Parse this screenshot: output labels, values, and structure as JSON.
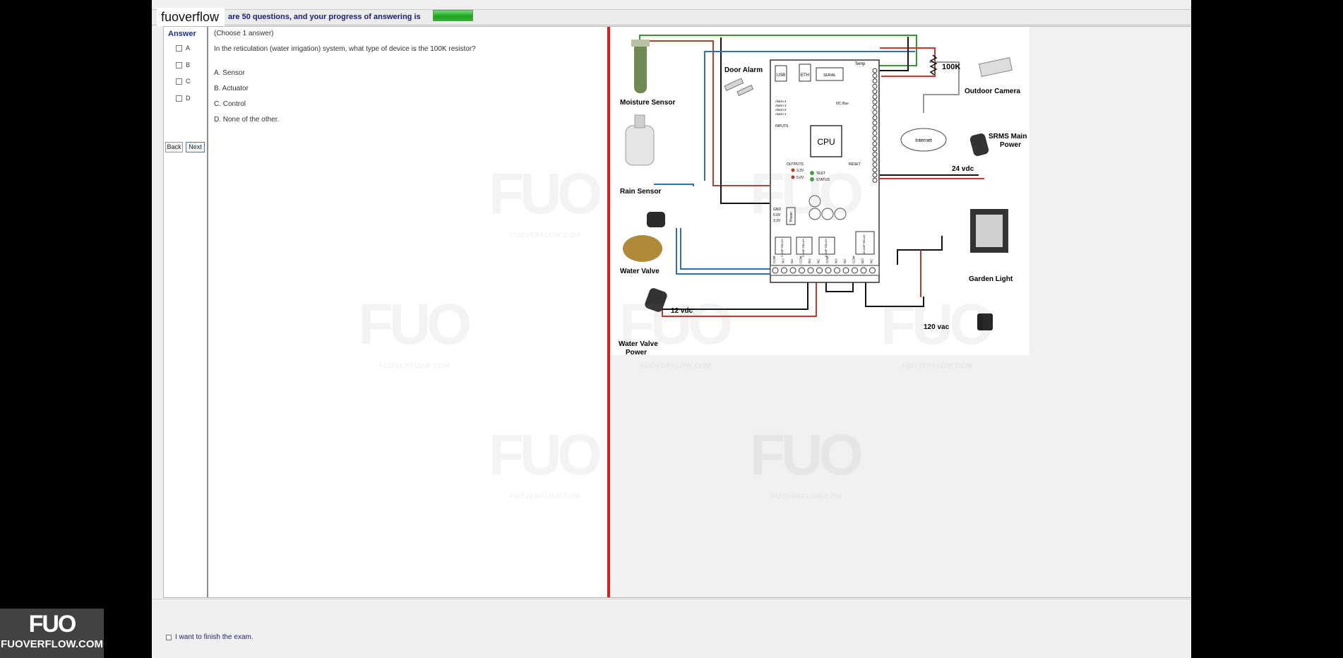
{
  "brand": "fuoverflow",
  "progress": {
    "text": "are 50 questions, and your progress of answering is",
    "fraction": 0.2
  },
  "answer_panel": {
    "title": "Answer",
    "options": [
      "A",
      "B",
      "C",
      "D"
    ],
    "back_label": "Back",
    "next_label": "Next"
  },
  "question": {
    "instruction": "(Choose 1 answer)",
    "stem": "In the reticulation  (water irrigation) system, what type of device is the 100K resistor?",
    "choices": [
      "A.  Sensor",
      "B.  Actuator",
      "C.  Control",
      "D.  None of the other."
    ]
  },
  "diagram": {
    "labels": {
      "moisture": "Moisture Sensor",
      "door": "Door Alarm",
      "rain": "Rain Sensor",
      "water_valve": "Water Valve",
      "v12": "12 vdc",
      "wv_power_1": "Water Valve",
      "wv_power_2": "Power",
      "resistor": "100K",
      "camera": "Outdoor Camera",
      "internet": "Internet",
      "srms_1": "SRMS Main",
      "srms_2": "Power",
      "v24": "24 vdc",
      "garden": "Garden Light",
      "v120": "120 vac"
    },
    "board": {
      "usb": "USB",
      "eth": "ETH",
      "serial": "SERIAL",
      "temp": "Temp",
      "cpu": "CPU",
      "inputs": "INPUTS",
      "outputs": "OUTPUTS",
      "reset": "RESET",
      "test": "TEST",
      "status": "STATUS",
      "v33": "3.3V",
      "v50": "5.0V",
      "i2c": "I2C Bus",
      "power": "Power",
      "alarms": [
        "Alarm 4",
        "Alarm 3",
        "Alarm 2",
        "Alarm 1"
      ],
      "gnd": [
        "GND",
        "5.0V",
        "3.3V"
      ],
      "relay_labels": [
        "5 AMP RELAY",
        "5 AMP RELAY",
        "5 AMP RELAY",
        "15 AMP RELAY"
      ],
      "terminal_row": [
        "COM",
        "NO",
        "NC",
        "COM",
        "NO",
        "NC",
        "COM",
        "NO",
        "NC",
        "COM",
        "NO",
        "NC"
      ]
    }
  },
  "footer": {
    "finish_label": "I want to finish the exam."
  },
  "watermark": {
    "mark": "FUO",
    "domain": "FUOVERFLOW.COM"
  },
  "colors": {
    "progress": "#2cb42c",
    "divider": "#dc1d1d",
    "accent_text": "#1c2e8c",
    "wire_red": "#c0392b",
    "wire_blue": "#2f6fae",
    "wire_green": "#2aa02a"
  }
}
